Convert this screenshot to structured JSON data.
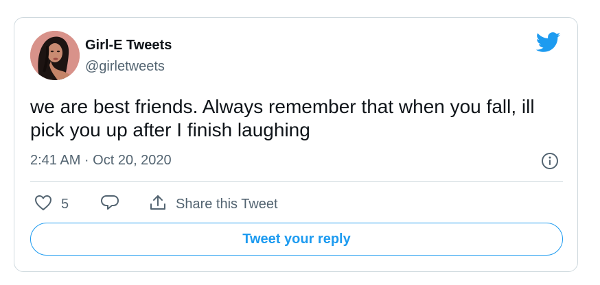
{
  "author": {
    "name": "Girl-E Tweets",
    "handle": "@girletweets"
  },
  "tweet": {
    "text": "we are best friends. Always remember that when you fall, ill pick you up after I finish laughing",
    "timestamp": "2:41 AM · Oct 20, 2020"
  },
  "actions": {
    "like_count": "5",
    "share_label": "Share this Tweet"
  },
  "reply_button": {
    "label": "Tweet your reply"
  },
  "icons": {
    "logo": "twitter-bird-icon",
    "info": "info-icon",
    "like": "heart-icon",
    "reply": "comment-icon",
    "share": "share-icon"
  },
  "colors": {
    "brand": "#1d9bf0",
    "text": "#0f1419",
    "muted": "#536471",
    "border": "#cfd9de"
  }
}
